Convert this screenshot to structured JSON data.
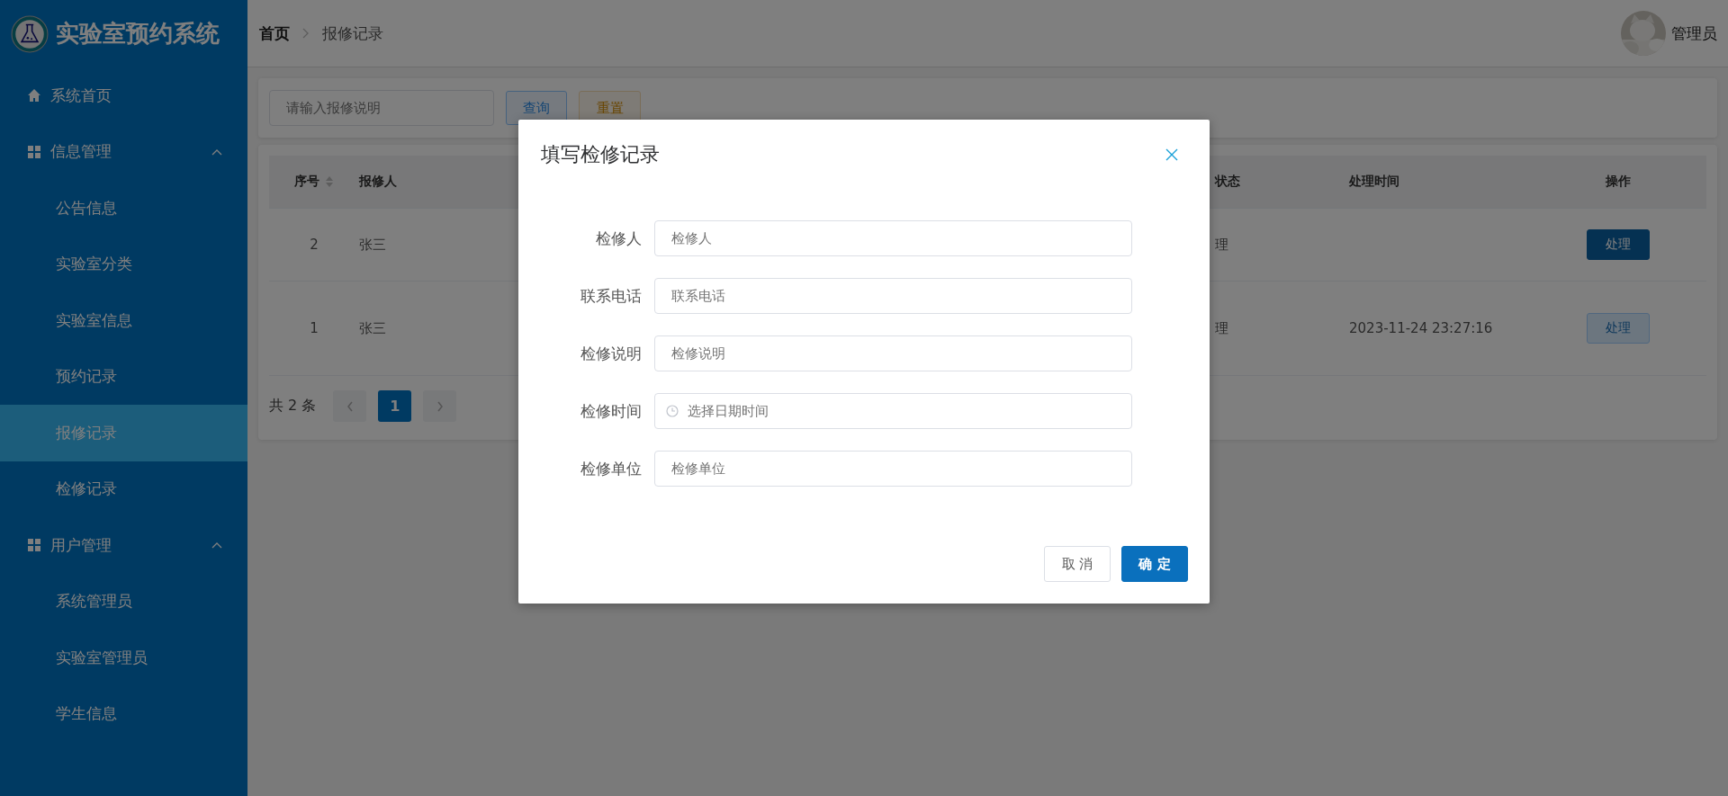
{
  "sidebar": {
    "title": "实验室预约系统",
    "items": [
      {
        "label": "系统首页",
        "kind": "link",
        "selected": false
      },
      {
        "label": "信息管理",
        "kind": "group",
        "expanded": true,
        "children": [
          {
            "label": "公告信息",
            "selected": false
          },
          {
            "label": "实验室分类",
            "selected": false
          },
          {
            "label": "实验室信息",
            "selected": false
          },
          {
            "label": "预约记录",
            "selected": false
          },
          {
            "label": "报修记录",
            "selected": true
          },
          {
            "label": "检修记录",
            "selected": false
          }
        ]
      },
      {
        "label": "用户管理",
        "kind": "group",
        "expanded": true,
        "children": [
          {
            "label": "系统管理员",
            "selected": false
          },
          {
            "label": "实验室管理员",
            "selected": false
          },
          {
            "label": "学生信息",
            "selected": false
          }
        ]
      }
    ]
  },
  "header": {
    "breadcrumb": [
      "首页",
      "报修记录"
    ],
    "user": "管理员",
    "avatar": {
      "kind": "picture"
    }
  },
  "search": {
    "placeholder": "请输入报修说明",
    "buttons": [
      {
        "label": "查询",
        "kind": "query"
      },
      {
        "label": "重置",
        "kind": "reset"
      }
    ]
  },
  "table": {
    "columns": [
      {
        "label": "序号",
        "sortable": true
      },
      {
        "label": "报修人",
        "sortable": false
      },
      {
        "label": "状态",
        "sortable": false
      },
      {
        "label": "处理时间",
        "sortable": false
      },
      {
        "label": "操作",
        "sortable": false
      }
    ],
    "rows": [
      {
        "cells": [
          "2",
          "张三",
          "理",
          ""
        ],
        "action": "处理",
        "disabled": false
      },
      {
        "cells": [
          "1",
          "张三",
          "理",
          "2023-11-24 23:27:16"
        ],
        "action": "处理",
        "disabled": true
      }
    ]
  },
  "pagination": {
    "total": "共 2 条",
    "pages": [
      {
        "label": "1",
        "selected": true
      }
    ]
  },
  "dialog": {
    "title": "填写检修记录",
    "fields": [
      {
        "label": "检修人",
        "placeholder": "检修人",
        "kind": "text"
      },
      {
        "label": "联系电话",
        "placeholder": "联系电话",
        "kind": "text"
      },
      {
        "label": "检修说明",
        "placeholder": "检修说明",
        "kind": "text"
      },
      {
        "label": "检修时间",
        "placeholder": "选择日期时间",
        "kind": "datetime"
      },
      {
        "label": "检修单位",
        "placeholder": "检修单位",
        "kind": "text"
      }
    ],
    "buttons": [
      {
        "label": "取 消",
        "kind": "default"
      },
      {
        "label": "确 定",
        "kind": "primary"
      }
    ]
  }
}
